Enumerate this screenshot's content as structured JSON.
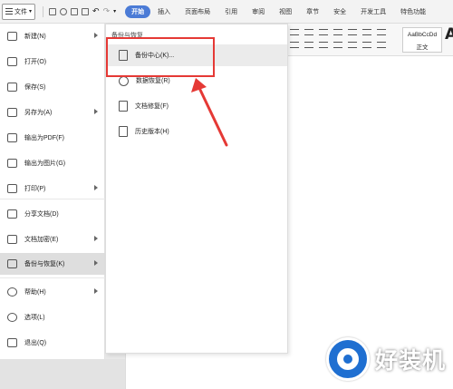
{
  "menubar": {
    "file_label": "文件",
    "tabs": [
      "开始",
      "插入",
      "页面布局",
      "引用",
      "审阅",
      "视图",
      "章节",
      "安全",
      "开发工具",
      "特色功能"
    ]
  },
  "ribbon": {
    "style_preview": "AaBbCcDd",
    "style_name": "正文",
    "big_letter": "A"
  },
  "file_menu": {
    "items": [
      {
        "label": "新建(N)",
        "icon": "new-doc-icon",
        "arrow": true
      },
      {
        "label": "打开(O)",
        "icon": "folder-icon",
        "arrow": false
      },
      {
        "label": "保存(S)",
        "icon": "save-icon",
        "arrow": false
      },
      {
        "label": "另存为(A)",
        "icon": "save-as-icon",
        "arrow": true
      },
      {
        "label": "输出为PDF(F)",
        "icon": "pdf-icon",
        "arrow": false
      },
      {
        "label": "输出为图片(G)",
        "icon": "image-icon",
        "arrow": false
      },
      {
        "label": "打印(P)",
        "icon": "printer-icon",
        "arrow": true
      },
      {
        "label": "分享文档(D)",
        "icon": "share-icon",
        "arrow": false
      },
      {
        "label": "文档加密(E)",
        "icon": "encrypt-icon",
        "arrow": true
      },
      {
        "label": "备份与恢复(K)",
        "icon": "backup-icon",
        "arrow": true
      },
      {
        "label": "帮助(H)",
        "icon": "help-icon",
        "arrow": true
      },
      {
        "label": "选项(L)",
        "icon": "gear-icon",
        "arrow": false
      },
      {
        "label": "退出(Q)",
        "icon": "exit-icon",
        "arrow": false
      }
    ]
  },
  "submenu": {
    "title": "备份与恢复",
    "items": [
      {
        "label": "备份中心(K)...",
        "icon": "backup-center-icon"
      },
      {
        "label": "数据恢复(R)",
        "icon": "data-recovery-icon"
      },
      {
        "label": "文档修复(F)",
        "icon": "doc-repair-icon"
      },
      {
        "label": "历史版本(H)",
        "icon": "history-version-icon"
      }
    ]
  },
  "watermark": {
    "text": "好装机"
  },
  "colors": {
    "accent": "#4b7bd6",
    "highlight_box": "#e53935",
    "watermark_blue": "#1f6fd1"
  }
}
